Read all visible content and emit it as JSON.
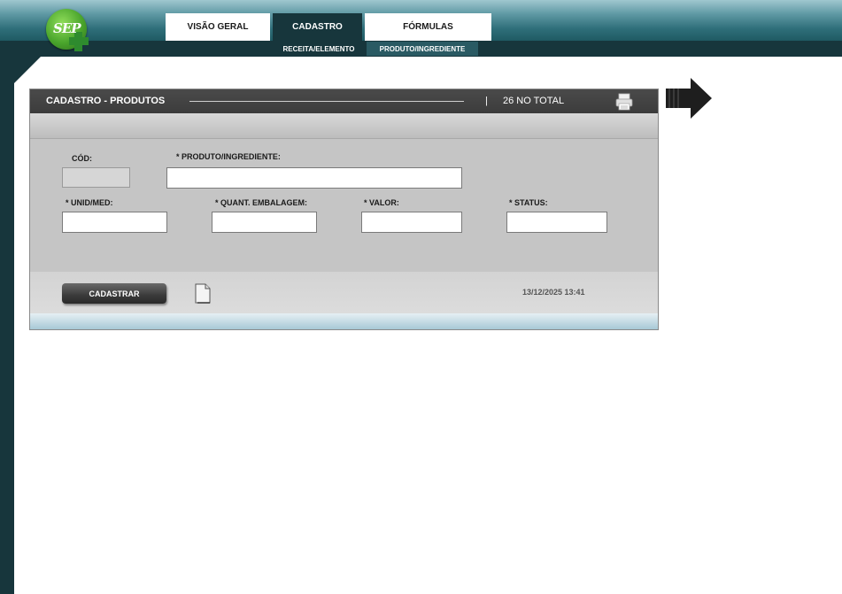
{
  "logo": {
    "text": "SEP"
  },
  "nav": {
    "tabs": [
      {
        "label": "VISÃO GERAL",
        "active": false
      },
      {
        "label": "CADASTRO",
        "active": true
      },
      {
        "label": "FÓRMULAS",
        "active": false
      }
    ],
    "subtabs": [
      {
        "label": "RECEITA/ELEMENTO",
        "active": false
      },
      {
        "label": "PRODUTO/INGREDIENTE",
        "active": true
      }
    ]
  },
  "panel": {
    "title": "CADASTRO - PRODUTOS",
    "separator": "|",
    "count": "26 NO TOTAL",
    "fields": {
      "cod": {
        "label": "CÓD:",
        "value": ""
      },
      "produto": {
        "label": "* PRODUTO/INGREDIENTE:",
        "value": ""
      },
      "unid": {
        "label": "* UNID/MED:",
        "value": ""
      },
      "quant": {
        "label": "* QUANT. EMBALAGEM:",
        "value": ""
      },
      "valor": {
        "label": "* VALOR:",
        "value": ""
      },
      "status": {
        "label": "* STATUS:",
        "value": ""
      }
    },
    "submit_label": "CADASTRAR",
    "timestamp": "13/12/2025 13:41"
  },
  "colors": {
    "dark_teal": "#17363c",
    "panel_grey": "#c5c5c5",
    "header_dark": "#3c3c3c"
  }
}
